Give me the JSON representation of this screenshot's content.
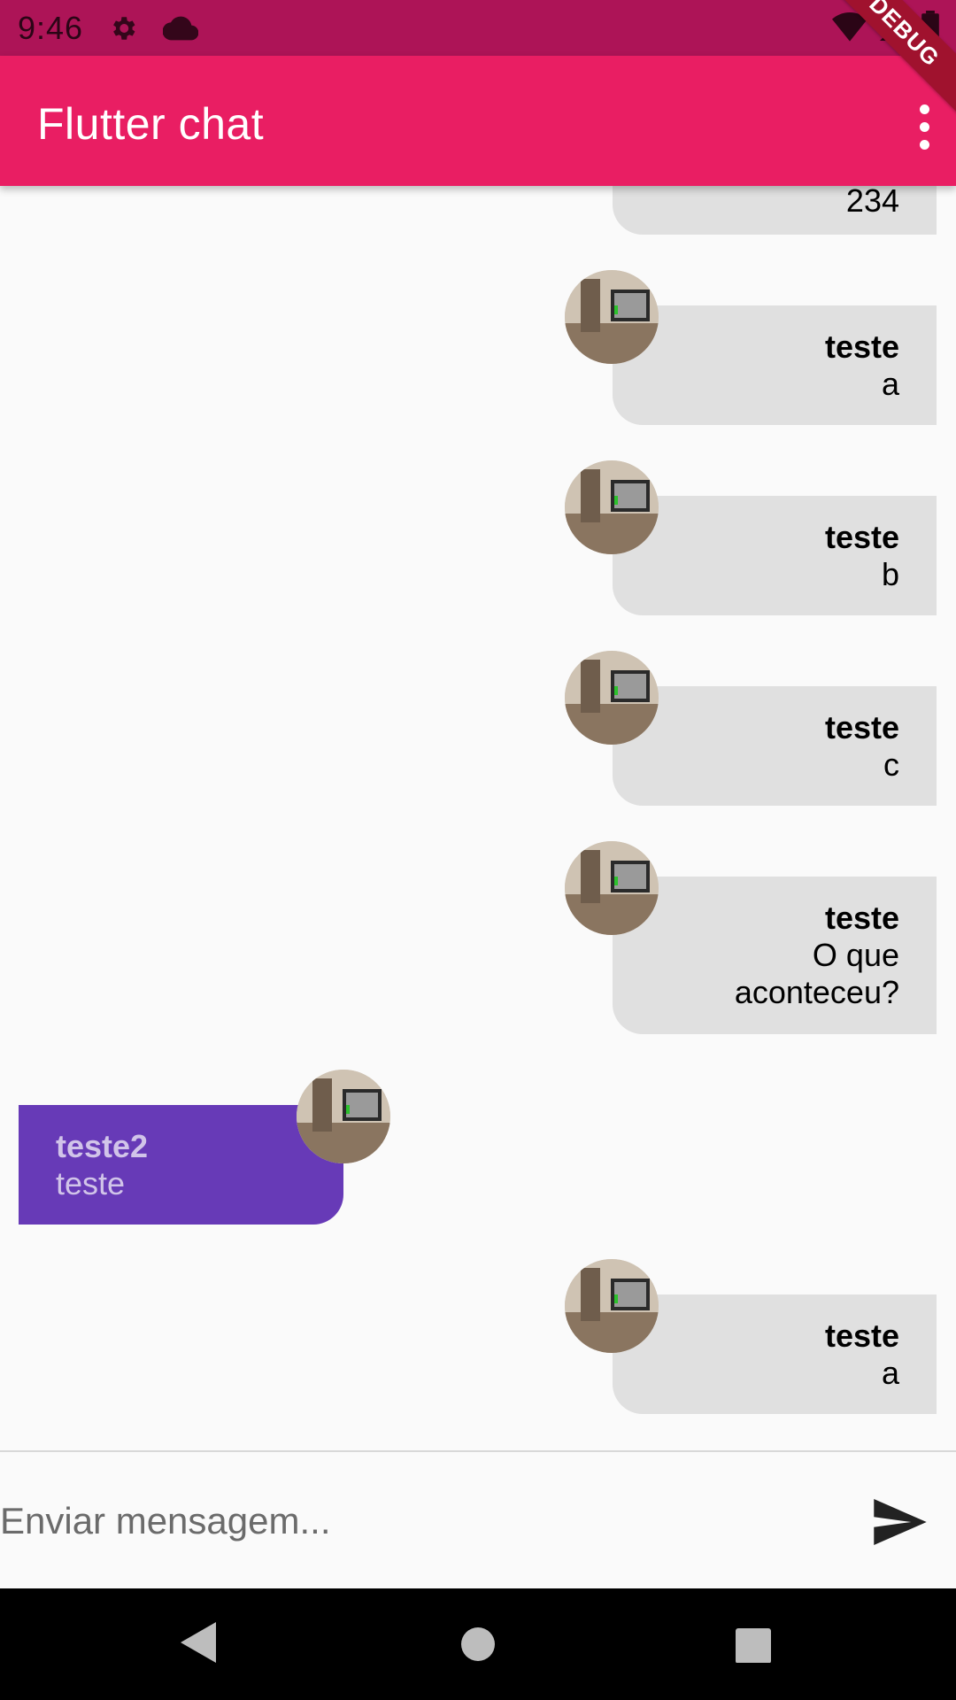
{
  "status_bar": {
    "time": "9:46",
    "icons": [
      "settings-icon",
      "cloud-icon",
      "wifi-icon",
      "signal-icon",
      "battery-icon"
    ]
  },
  "app_bar": {
    "title": "Flutter chat",
    "debug_banner": "DEBUG",
    "background": "#e91e63"
  },
  "messages": [
    {
      "from": "me",
      "sender": "",
      "text": "234"
    },
    {
      "from": "me",
      "sender": "teste",
      "text": "a"
    },
    {
      "from": "me",
      "sender": "teste",
      "text": "b"
    },
    {
      "from": "me",
      "sender": "teste",
      "text": "c"
    },
    {
      "from": "me",
      "sender": "teste",
      "text_lines": [
        "O que",
        "aconteceu?"
      ]
    },
    {
      "from": "other",
      "sender": "teste2",
      "text": "teste"
    },
    {
      "from": "me",
      "sender": "teste",
      "text": "a"
    }
  ],
  "composer": {
    "placeholder": "Enviar mensagem...",
    "value": ""
  },
  "colors": {
    "status_bar": "#ad1457",
    "my_bubble": "#e0e0e0",
    "other_bubble": "#673ab7",
    "other_text": "#d1c4e9"
  },
  "nav_bar": {
    "buttons": [
      "back-icon",
      "home-icon",
      "recents-icon"
    ]
  }
}
